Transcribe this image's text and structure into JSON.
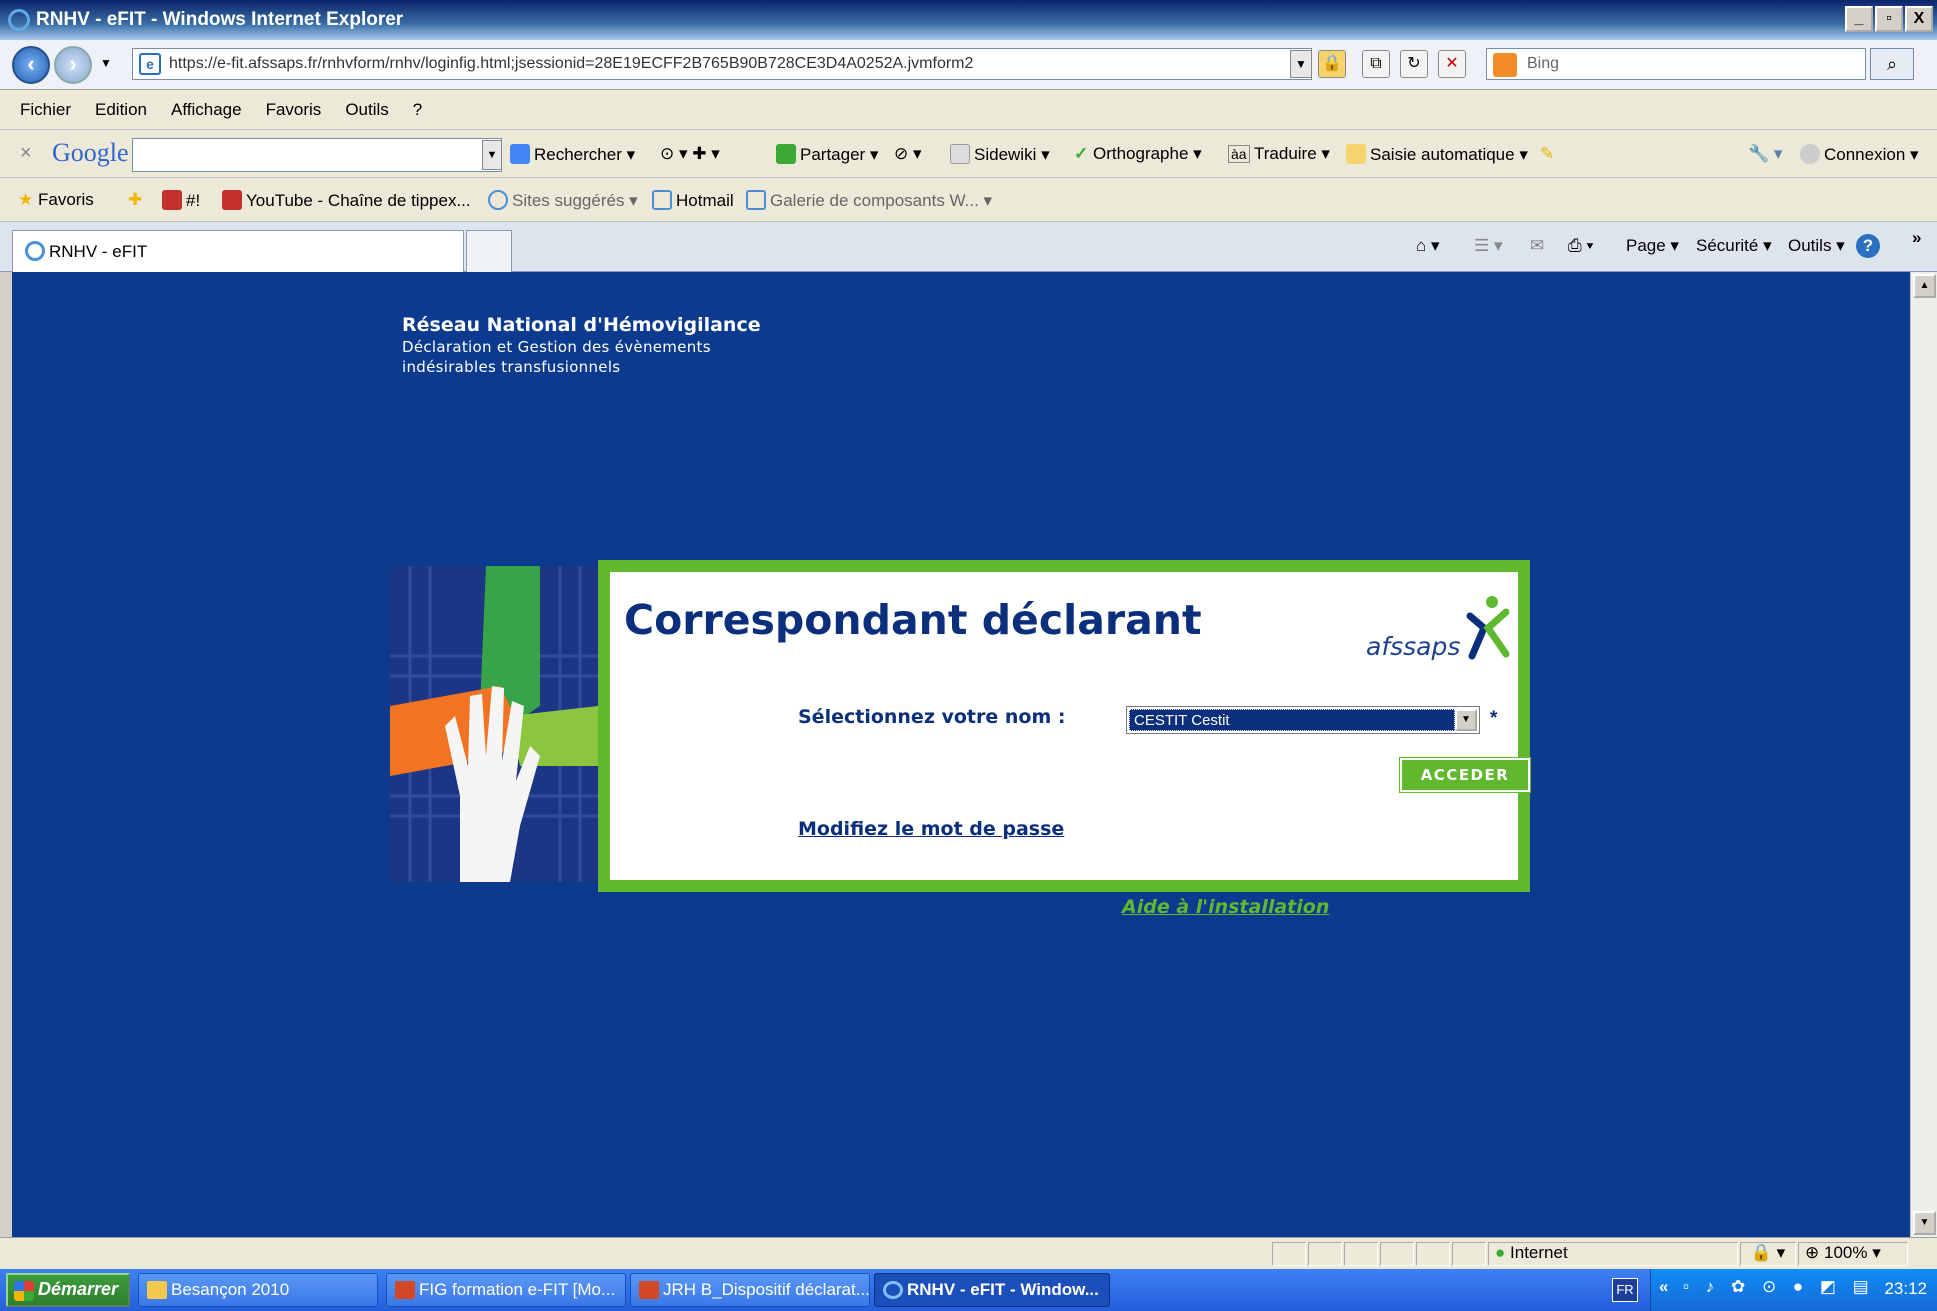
{
  "window": {
    "title": "RNHV - eFIT - Windows Internet Explorer",
    "min": "_",
    "max": "▫",
    "close": "X"
  },
  "address": {
    "url": "https://e-fit.afssaps.fr/rnhvform/rnhv/loginfig.html;jsessionid=28E19ECFF2B765B90B728CE3D4A0252A.jvmform2",
    "search_placeholder": "Bing"
  },
  "menu": [
    "Fichier",
    "Edition",
    "Affichage",
    "Favoris",
    "Outils",
    "?"
  ],
  "google": {
    "logo": "Google",
    "items": [
      "Rechercher ▾",
      "Partager ▾",
      "Sidewiki ▾",
      "Orthographe ▾",
      "Traduire ▾",
      "Saisie automatique ▾",
      "Connexion ▾"
    ]
  },
  "favorites": {
    "label": "Favoris",
    "items": [
      "#!",
      "YouTube - Chaîne de tippex...",
      "Sites suggérés ▾",
      "Hotmail",
      "Galerie de composants W... ▾"
    ]
  },
  "tab": {
    "label": "RNHV - eFIT"
  },
  "commandbar": {
    "page": "Page ▾",
    "security": "Sécurité ▾",
    "tools": "Outils ▾",
    "help": "?"
  },
  "page": {
    "site_title": "Réseau National d'Hémovigilance",
    "site_sub1": "Déclaration et Gestion des évènements",
    "site_sub2": "indésirables transfusionnels",
    "panel_title": "Correspondant déclarant",
    "logo_text": "afssaps",
    "select_label": "Sélectionnez votre nom :",
    "selected_name": "CESTIT Cestit",
    "required_mark": "*",
    "accede_label": "ACCEDER",
    "password_link": "Modifiez le mot de passe",
    "help_link": "Aide à l'installation"
  },
  "status": {
    "zone": "Internet",
    "zoom": "100%"
  },
  "taskbar": {
    "start": "Démarrer",
    "tasks": [
      "Besançon 2010",
      "FIG formation e-FIT [Mo...",
      "JRH B_Dispositif déclarat...",
      "RNHV - eFIT - Window..."
    ],
    "lang": "FR",
    "clock": "23:12"
  },
  "colors": {
    "page_bg": "#0b3a8e",
    "accent_green": "#5fb82e",
    "navy": "#0b2f7c"
  }
}
